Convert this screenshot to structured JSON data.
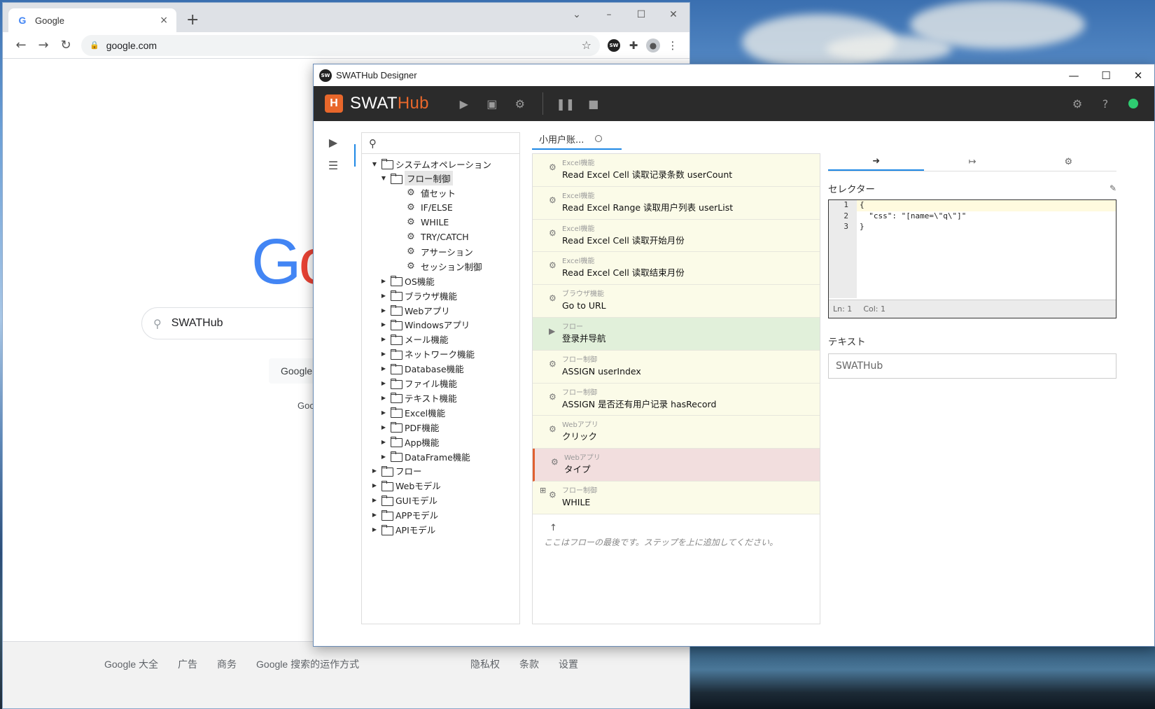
{
  "chrome": {
    "tab_title": "Google",
    "tab_close": "×",
    "new_tab": "+",
    "url": "google.com",
    "search_query": "SWATHub",
    "search_button": "Google",
    "offer_text": "Goo",
    "footer_left": [
      "Google 大全",
      "广告",
      "商务",
      "Google 搜索的运作方式"
    ],
    "footer_right": [
      "隐私权",
      "条款",
      "设置"
    ]
  },
  "swat": {
    "window_title": "SWATHub Designer",
    "brand_swat": "SWAT",
    "brand_hub": "Hub",
    "flow_tab": "小用户账...",
    "tree": {
      "root": "システムオペレーション",
      "flow_ctrl": "フロー制御",
      "flow_items": [
        "値セット",
        "IF/ELSE",
        "WHILE",
        "TRY/CATCH",
        "アサーション",
        "セッション制御"
      ],
      "sub_folders": [
        "OS機能",
        "ブラウザ機能",
        "Webアプリ",
        "Windowsアプリ",
        "メール機能",
        "ネットワーク機能",
        "Database機能",
        "ファイル機能",
        "テキスト機能",
        "Excel機能",
        "PDF機能",
        "App機能",
        "DataFrame機能"
      ],
      "top_folders": [
        "フロー",
        "Webモデル",
        "GUIモデル",
        "APPモデル",
        "APIモデル"
      ]
    },
    "steps": [
      {
        "cat": "Excel機能",
        "name": "Read Excel Cell 读取记录条数 userCount"
      },
      {
        "cat": "Excel機能",
        "name": "Read Excel Range 读取用户列表 userList"
      },
      {
        "cat": "Excel機能",
        "name": "Read Excel Cell 读取开始月份"
      },
      {
        "cat": "Excel機能",
        "name": "Read Excel Cell 读取结束月份"
      },
      {
        "cat": "ブラウザ機能",
        "name": "Go to URL"
      },
      {
        "cat": "フロー",
        "name": "登录并导航"
      },
      {
        "cat": "フロー制御",
        "name": "ASSIGN userIndex"
      },
      {
        "cat": "フロー制御",
        "name": "ASSIGN 是否还有用户记录 hasRecord"
      },
      {
        "cat": "Webアプリ",
        "name": "クリック"
      },
      {
        "cat": "Webアプリ",
        "name": "タイプ"
      },
      {
        "cat": "フロー制御",
        "name": "WHILE"
      }
    ],
    "flow_end_msg": "ここはフローの最後です。ステップを上に追加してください。",
    "selector_label": "セレクター",
    "code_lines": [
      "{",
      "  \"css\": \"[name=\\\"q\\\"]\"",
      "}"
    ],
    "line_numbers": [
      "1",
      "2",
      "3"
    ],
    "editor_ln": "Ln: 1",
    "editor_col": "Col: 1",
    "text_label": "テキスト",
    "text_value": "SWATHub"
  }
}
